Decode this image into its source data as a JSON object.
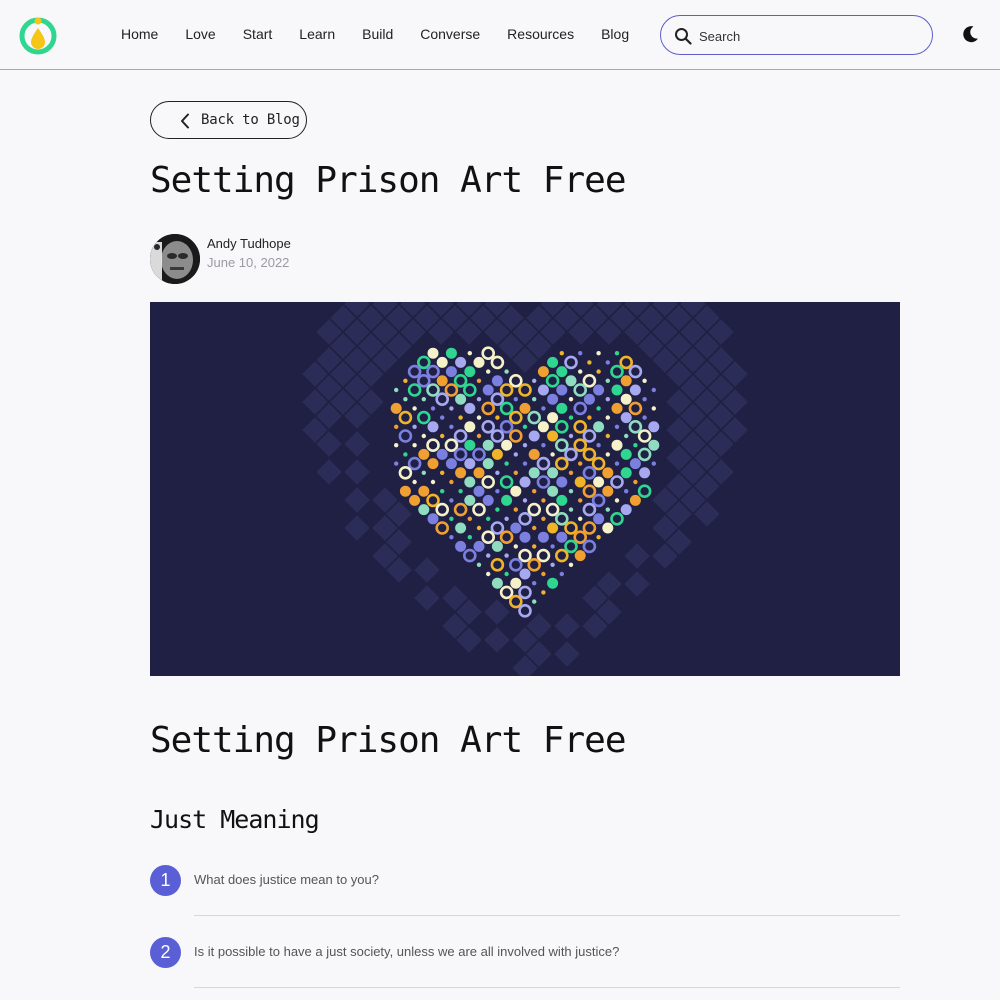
{
  "nav": {
    "items": [
      "Home",
      "Love",
      "Start",
      "Learn",
      "Build",
      "Converse",
      "Resources",
      "Blog"
    ]
  },
  "search": {
    "placeholder": "Search"
  },
  "back": {
    "label": "Back to Blog"
  },
  "post": {
    "title": "Setting Prison Art Free",
    "author": "Andy Tudhope",
    "date": "June 10, 2022",
    "heading": "Setting Prison Art Free",
    "subheading": "Just Meaning",
    "questions": [
      {
        "num": "1",
        "text": "What does justice mean to you?"
      },
      {
        "num": "2",
        "text": "Is it possible to have a just society, unless we are all involved with justice?"
      }
    ]
  },
  "colors": {
    "accent": "#5b5fd6",
    "hero_bg": "#202044",
    "logo_green": "#2fd68f",
    "logo_yellow": "#f5c518"
  },
  "icons": {
    "logo": "drop-in-ring-logo",
    "search": "search-icon",
    "theme": "moon-icon",
    "back": "chevron-left-icon"
  }
}
